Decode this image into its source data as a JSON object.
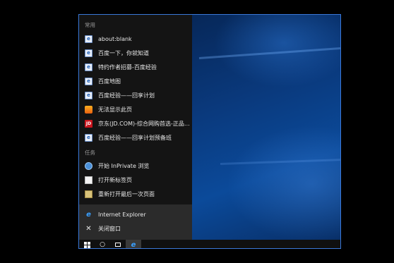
{
  "jumplist": {
    "frequent_title": "常用",
    "frequent": [
      {
        "label": "about:blank",
        "icon": "ie-page-icon"
      },
      {
        "label": "百度一下，你就知道",
        "icon": "ie-page-icon"
      },
      {
        "label": "特约作者招募-百度经验",
        "icon": "ie-page-icon"
      },
      {
        "label": "百度地图",
        "icon": "ie-page-icon"
      },
      {
        "label": "百度经验——回享计划",
        "icon": "ie-page-icon"
      },
      {
        "label": "无法显示此页",
        "icon": "error-page-icon"
      },
      {
        "label": "京东(JD.COM)-综合网购首选-正品低...",
        "icon": "jd-icon",
        "icon_text": "JD"
      },
      {
        "label": "百度经验——回享计划预备班",
        "icon": "ie-page-icon"
      }
    ],
    "tasks_title": "任务",
    "tasks": [
      {
        "label": "开始 InPrivate 浏览",
        "icon": "inprivate-icon"
      },
      {
        "label": "打开新标签页",
        "icon": "new-tab-icon"
      },
      {
        "label": "重新打开最后一次页面",
        "icon": "reopen-icon"
      }
    ],
    "app_label": "Internet Explorer",
    "close_label": "关闭窗口"
  },
  "taskbar": {
    "buttons": [
      "start-button",
      "search-button",
      "task-view-button",
      "internet-explorer-button"
    ]
  },
  "colors": {
    "jumplist_bg": "#141414",
    "app_area_bg": "#2b2b2b",
    "screen_border": "#3a78d8",
    "ie_blue": "#3aa0ff",
    "jd_red": "#c9151e"
  }
}
